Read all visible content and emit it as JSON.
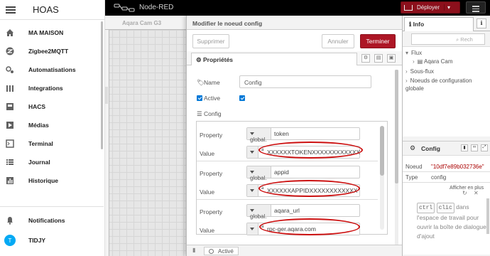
{
  "ha": {
    "title": "HOAS",
    "nav": [
      {
        "label": "MA MAISON",
        "icon": "home-icon"
      },
      {
        "label": "Zigbee2MQTT",
        "icon": "zigbee-icon"
      },
      {
        "label": "Automatisations",
        "icon": "robot-icon"
      },
      {
        "label": "Integrations",
        "icon": "puzzle-icon"
      },
      {
        "label": "HACS",
        "icon": "hacs-icon"
      },
      {
        "label": "Médias",
        "icon": "media-icon"
      },
      {
        "label": "Terminal",
        "icon": "terminal-icon"
      },
      {
        "label": "Journal",
        "icon": "list-icon"
      },
      {
        "label": "Historique",
        "icon": "chart-bar-icon"
      }
    ],
    "notifications": "Notifications",
    "user": {
      "initial": "T",
      "name": "TIDJY"
    }
  },
  "nodered": {
    "title": "Node-RED",
    "deploy_label": "Déployer",
    "workspace_tab": "Aqara Cam G3"
  },
  "tray": {
    "title": "Modifier le noeud config",
    "delete_label": "Supprimer",
    "cancel_label": "Annuler",
    "done_label": "Terminer",
    "tab_label": "Propriétés",
    "name_label": "Name",
    "name_value": "Config",
    "active_label": "Active",
    "config_label": "Config",
    "env": [
      {
        "property_label": "Property",
        "type": "global.",
        "key": "token",
        "value_label": "Value",
        "value_type": "a",
        "value": "XXXXXXTOKENXXXXXXXXXXXX"
      },
      {
        "property_label": "Property",
        "type": "global.",
        "key": "appid",
        "value_label": "Value",
        "value_type": "a",
        "value": "XXXXXXAPPIDXXXXXXXXXXXX"
      },
      {
        "property_label": "Property",
        "type": "global.",
        "key": "aqara_url",
        "value_label": "Value",
        "value_type": "a",
        "value": "rpc-ger.aqara.com"
      }
    ],
    "status_label": "Activé"
  },
  "info": {
    "tab_label": "Info",
    "search_placeholder": "Rech",
    "flux_label": "Flux",
    "flow_name": "Aqara Cam",
    "subflows_label": "Sous-flux",
    "global_config_label": "Noeuds de configuration globale",
    "node_title": "Config",
    "node_key": "Noeud",
    "node_id": "\"10df7e89b032736e\"",
    "type_key": "Type",
    "type_value": "config",
    "show_more": "Afficher en plus",
    "help_key1": "ctrl",
    "help_key2": "clic",
    "help_text_1": "dans",
    "help_text_2": "l'espace de travail pour ouvrir la boîte de dialogue d'ajout"
  },
  "colors": {
    "deploy": "#8c101c",
    "primary_button": "#ad1625",
    "accent_checkbox": "#0078d7",
    "highlight_oval": "#cc1010"
  }
}
